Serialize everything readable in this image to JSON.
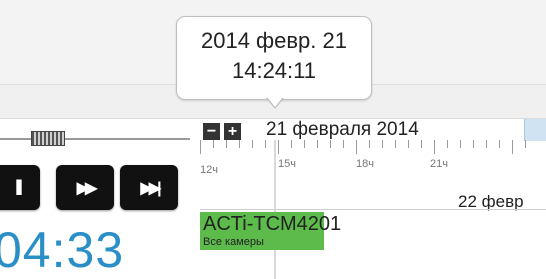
{
  "tooltip": {
    "date": "2014 февр. 21",
    "time": "14:24:11"
  },
  "player": {
    "time": "04:33",
    "buttons": [
      {
        "name": "pause",
        "icon": "pause-icon",
        "glyph": "II"
      },
      {
        "name": "fast-forward",
        "icon": "fast-forward-icon",
        "glyph": "▶▶"
      },
      {
        "name": "skip-to-end",
        "icon": "skip-to-end-icon",
        "glyph": "▶▶|"
      }
    ]
  },
  "timeline": {
    "zoom_out": "−",
    "zoom_in": "+",
    "date_label": "21 февраля 2014",
    "hour_labels": [
      "12ч",
      "15ч",
      "18ч",
      "21ч"
    ],
    "next_date": "22 февр"
  },
  "camera": {
    "name": "ACTi-TCM4201",
    "group": "Все камеры"
  },
  "colors": {
    "accent": "#2a8fc6",
    "recording": "#5cbb4b"
  }
}
